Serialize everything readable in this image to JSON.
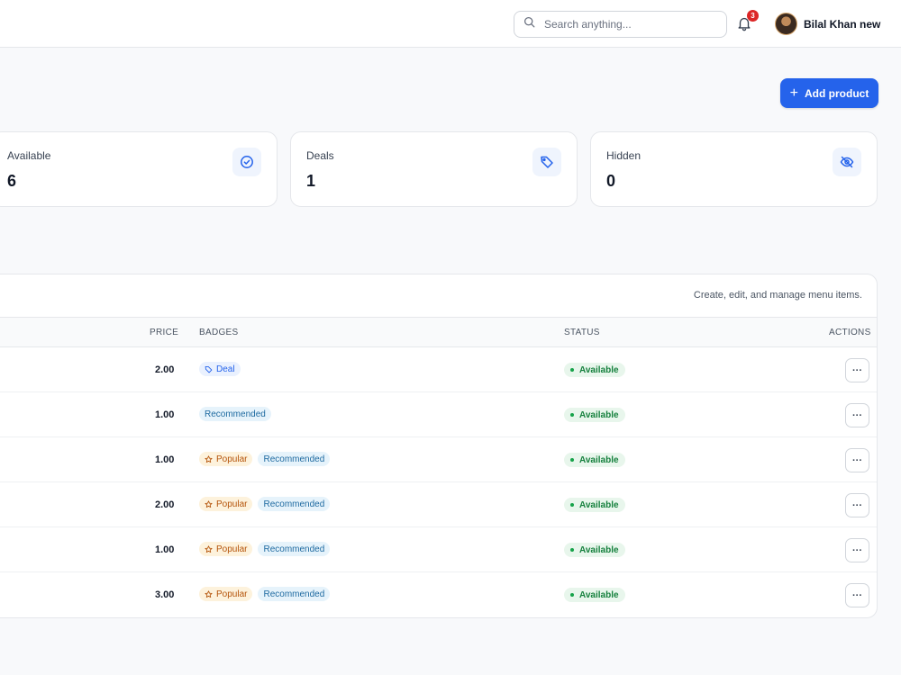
{
  "header": {
    "search_placeholder": "Search anything...",
    "notification_count": "3",
    "user_name": "Bilal Khan new"
  },
  "toolbar": {
    "add_product_label": "Add product"
  },
  "stats": [
    {
      "label": "Available",
      "value": "6",
      "icon": "check-circle-icon"
    },
    {
      "label": "Deals",
      "value": "1",
      "icon": "tag-icon"
    },
    {
      "label": "Hidden",
      "value": "0",
      "icon": "eye-off-icon"
    }
  ],
  "table": {
    "subtitle": "Create, edit, and manage menu items.",
    "columns": {
      "price": "PRICE",
      "badges": "BADGES",
      "status": "STATUS",
      "actions": "ACTIONS"
    },
    "rows": [
      {
        "price": "2.00",
        "badges": [
          "Deal"
        ],
        "status": "Available"
      },
      {
        "price": "1.00",
        "badges": [
          "Recommended"
        ],
        "status": "Available"
      },
      {
        "price": "1.00",
        "badges": [
          "Popular",
          "Recommended"
        ],
        "status": "Available"
      },
      {
        "price": "2.00",
        "badges": [
          "Popular",
          "Recommended"
        ],
        "status": "Available"
      },
      {
        "price": "1.00",
        "badges": [
          "Popular",
          "Recommended"
        ],
        "status": "Available"
      },
      {
        "price": "3.00",
        "badges": [
          "Popular",
          "Recommended"
        ],
        "status": "Available"
      }
    ],
    "more_glyph": "···"
  },
  "colors": {
    "accent": "#2563eb",
    "status_green": "#15803d",
    "badge_popular": "#b45309",
    "badge_recommended": "#1e6aa0",
    "notification_red": "#dc2626"
  }
}
